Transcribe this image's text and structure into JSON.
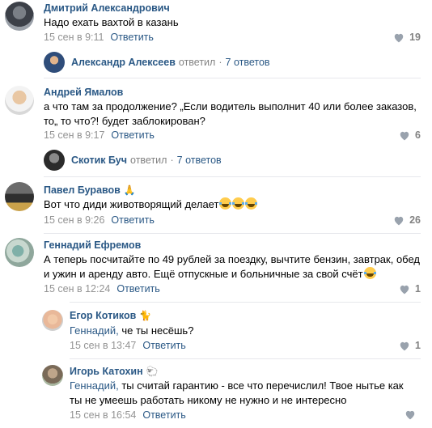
{
  "comments": [
    {
      "author": "Дмитрий Александрович",
      "text": "Надо ехать вахтой в казань",
      "date": "15 сен в 9:11",
      "reply": "Ответить",
      "likes": "19"
    },
    {
      "author": "Андрей Ямалов",
      "text": "а что там за продолжение? „Если водитель выполнит 40 или более заказов, то„ то что?! будет заблокирован?",
      "date": "15 сен в 9:17",
      "reply": "Ответить",
      "likes": "6"
    },
    {
      "author": "Павел Буравов",
      "text": "Вот что диди животворящий делает",
      "date": "15 сен в 9:26",
      "reply": "Ответить",
      "likes": "26"
    },
    {
      "author": "Геннадий Ефремов",
      "text": "А теперь посчитайте по 49 рублей за поездку, вычтите бензин, завтрак, обед и ужин и аренду авто. Ещё отпускные и больничные за свой счёт",
      "date": "15 сен в 12:24",
      "reply": "Ответить",
      "likes": "1"
    }
  ],
  "threads": [
    {
      "name": "Александр Алексеев",
      "action": "ответил",
      "count": "7 ответов"
    },
    {
      "name": "Скотик Буч",
      "action": "ответил",
      "count": "7 ответов"
    }
  ],
  "replies": [
    {
      "author": "Егор Котиков",
      "addressee": "Геннадий,",
      "text": " че ты несёшь?",
      "date": "15 сен в 13:47",
      "reply": "Ответить",
      "likes": "1"
    },
    {
      "author": "Игорь Катохин",
      "addressee": "Геннадий,",
      "text": " ты считай гарантию - все что перечислил! Твое нытье как ты не умеешь работать никому не нужно и не интересно",
      "date": "15 сен в 16:54",
      "reply": "Ответить",
      "likes": ""
    }
  ],
  "colors": {
    "link": "#2a5885",
    "meta": "#939393",
    "divider": "#e7e8ec"
  },
  "icons": [
    "heart-icon",
    "praying-hands-icon",
    "cat-icon",
    "sheep-icon",
    "laughing-emoji"
  ]
}
